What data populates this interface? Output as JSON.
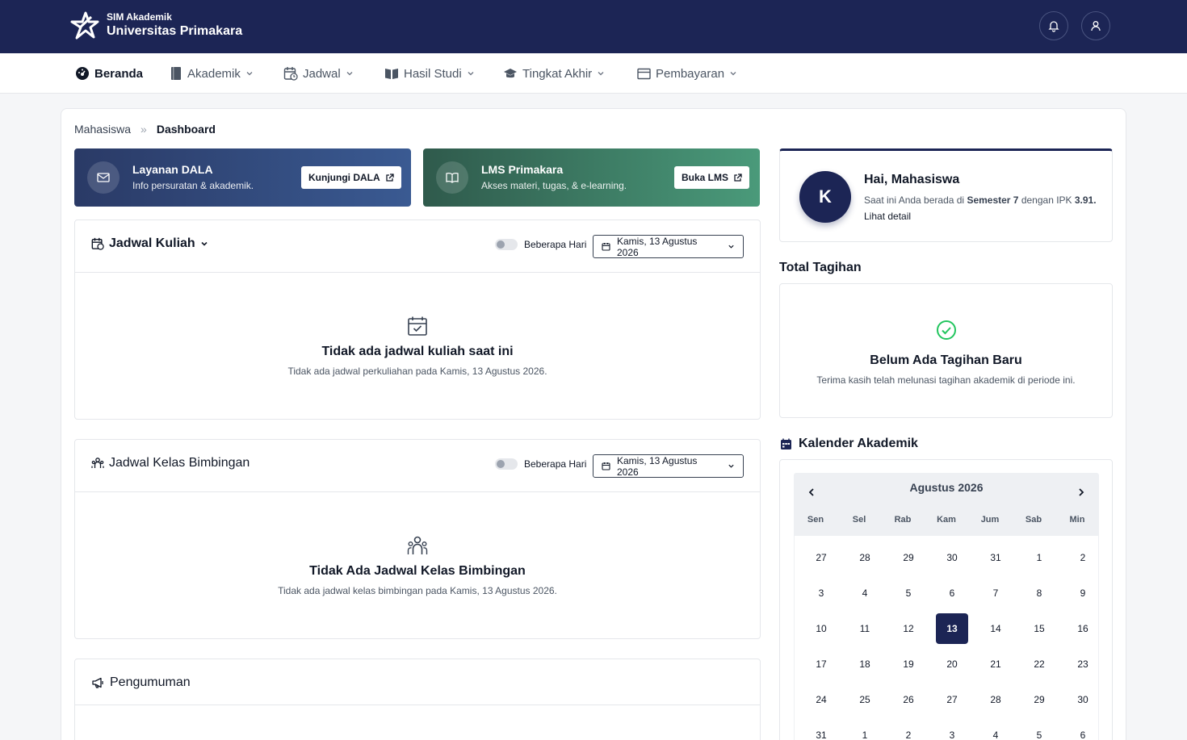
{
  "header": {
    "app_small": "SIM Akademik",
    "app_name": "Universitas Primakara",
    "icons": [
      "bell-icon",
      "user-icon"
    ]
  },
  "nav": {
    "items": [
      {
        "label": "Beranda",
        "icon": "dashboard-icon",
        "active": true
      },
      {
        "label": "Akademik",
        "icon": "book-icon"
      },
      {
        "label": "Jadwal",
        "icon": "calendar-clock-icon"
      },
      {
        "label": "Hasil Studi",
        "icon": "open-book-icon"
      },
      {
        "label": "Tingkat Akhir",
        "icon": "graduation-cap-icon"
      },
      {
        "label": "Pembayaran",
        "icon": "wallet-icon"
      }
    ]
  },
  "breadcrumb": {
    "parent": "Mahasiswa",
    "separator": "»",
    "current": "Dashboard"
  },
  "banners": [
    {
      "title": "Layanan DALA",
      "subtitle": "Info persuratan & akademik.",
      "button": "Kunjungi DALA",
      "icon": "mail-icon"
    },
    {
      "title": "LMS Primakara",
      "subtitle": "Akses materi, tugas, & e-learning.",
      "button": "Buka LMS",
      "icon": "book-open-icon"
    }
  ],
  "jadwal_kuliah": {
    "title": "Jadwal Kuliah",
    "toggle_label": "Beberapa Hari",
    "date": "Kamis, 13 Agustus 2026",
    "empty_title": "Tidak ada jadwal kuliah saat ini",
    "empty_sub": "Tidak ada jadwal perkuliahan pada Kamis, 13 Agustus 2026."
  },
  "jadwal_bimbingan": {
    "title": "Jadwal Kelas Bimbingan",
    "toggle_label": "Beberapa Hari",
    "date": "Kamis, 13 Agustus 2026",
    "empty_title": "Tidak Ada Jadwal Kelas Bimbingan",
    "empty_sub": "Tidak ada jadwal kelas bimbingan pada Kamis, 13 Agustus 2026."
  },
  "pengumuman": {
    "title": "Pengumuman"
  },
  "profile": {
    "initial": "K",
    "greeting": "Hai, Mahasiswa",
    "desc_prefix": "Saat ini Anda berada di ",
    "semester": "Semester 7",
    "desc_mid": " dengan IPK ",
    "ipk": "3.91.",
    "link": " Lihat detail"
  },
  "tagihan": {
    "heading": "Total Tagihan",
    "title": "Belum Ada Tagihan Baru",
    "subtitle": "Terima kasih telah melunasi tagihan akademik di periode ini."
  },
  "calendar": {
    "heading": "Kalender Akademik",
    "month": "Agustus 2026",
    "days_of_week": [
      "Sen",
      "Sel",
      "Rab",
      "Kam",
      "Jum",
      "Sab",
      "Min"
    ],
    "weeks": [
      [
        "27",
        "28",
        "29",
        "30",
        "31",
        "1",
        "2"
      ],
      [
        "3",
        "4",
        "5",
        "6",
        "7",
        "8",
        "9"
      ],
      [
        "10",
        "11",
        "12",
        "13",
        "14",
        "15",
        "16"
      ],
      [
        "17",
        "18",
        "19",
        "20",
        "21",
        "22",
        "23"
      ],
      [
        "24",
        "25",
        "26",
        "27",
        "28",
        "29",
        "30"
      ],
      [
        "31",
        "1",
        "2",
        "3",
        "4",
        "5",
        "6"
      ]
    ],
    "selected": "13"
  }
}
